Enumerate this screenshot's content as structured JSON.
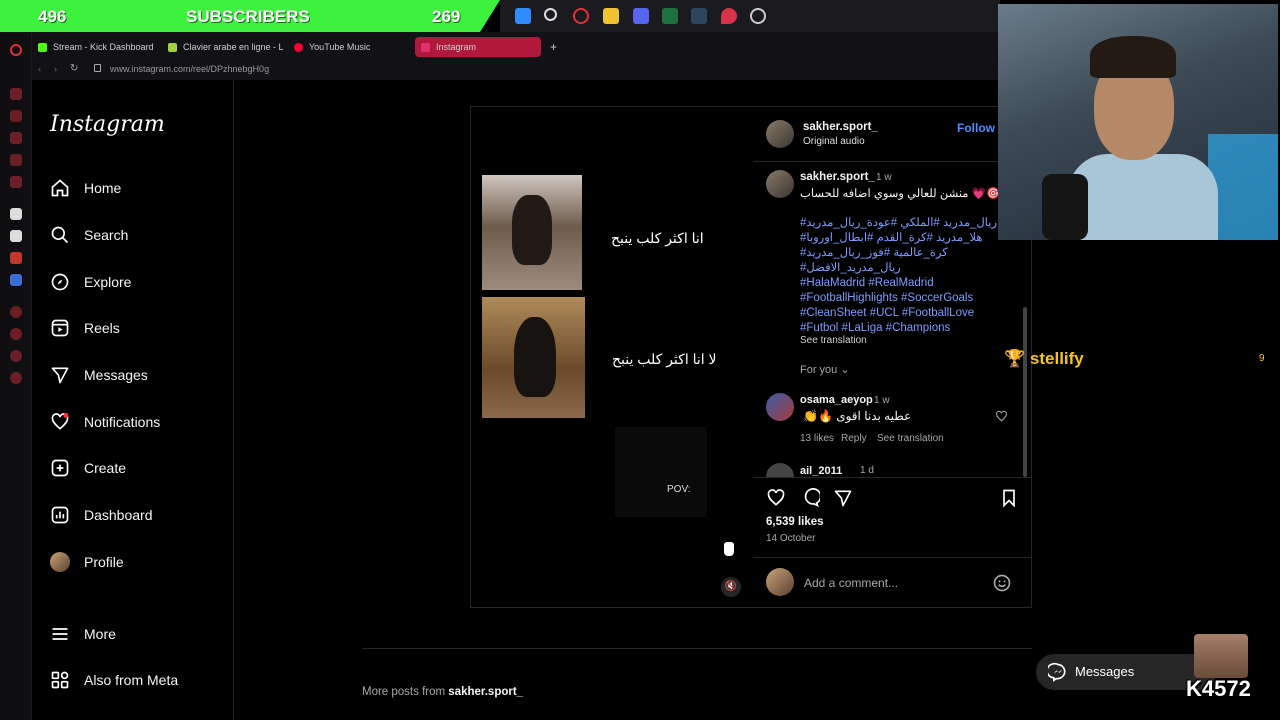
{
  "stream": {
    "subs_left": "496",
    "subs_label": "SUBSCRIBERS",
    "subs_right": "269"
  },
  "browser": {
    "tabs": [
      {
        "label": "Stream - Kick Dashboard",
        "color": "#53fc18"
      },
      {
        "label": "Clavier arabe en ligne - L",
        "color": "#a3d13b"
      },
      {
        "label": "YouTube Music",
        "color": "#ff0033"
      },
      {
        "label": "Instagram",
        "color": "#e1306c"
      }
    ],
    "new_tab": "+",
    "url": "www.instagram.com/reel/DPzhnebgH0g"
  },
  "instagram": {
    "logo": "Instagram",
    "nav": [
      {
        "label": "Home",
        "icon": "home-icon"
      },
      {
        "label": "Search",
        "icon": "search-icon"
      },
      {
        "label": "Explore",
        "icon": "compass-icon"
      },
      {
        "label": "Reels",
        "icon": "reels-icon"
      },
      {
        "label": "Messages",
        "icon": "send-icon"
      },
      {
        "label": "Notifications",
        "icon": "heart-icon"
      },
      {
        "label": "Create",
        "icon": "plus-square-icon"
      },
      {
        "label": "Dashboard",
        "icon": "chart-icon"
      },
      {
        "label": "Profile",
        "icon": "avatar"
      },
      {
        "label": "More",
        "icon": "menu-icon"
      },
      {
        "label": "Also from Meta",
        "icon": "meta-icon"
      }
    ]
  },
  "post": {
    "video": {
      "caption1": "انا اكثر كلب ينبح",
      "caption2": "لا انا اكثر كلب ينبح",
      "pov": "POV:"
    },
    "header": {
      "username": "sakher.sport_",
      "audio": "Original audio",
      "follow": "Follow"
    },
    "caption": {
      "username": "sakher.sport_",
      "time": "1 w",
      "text": "منشن للعالي وسوي اضافه للحساب 💗🎯",
      "hashtags": [
        "#ريال_مدريد #الملكي #عودة_ريال_مدريد",
        "#هلا_مدريد #كرة_القدم #ابطال_اوروبا",
        "#كرة_عالمية #فوز_ريال_مدريد",
        "#ريال_مدريد_الافضل",
        "#HalaMadrid #RealMadrid",
        "#FootballHighlights #SoccerGoals",
        "#CleanSheet #UCL #FootballLove",
        "#Futbol #LaLiga #Champions"
      ],
      "see_translation": "See translation"
    },
    "for_you": "For you",
    "comments": [
      {
        "username": "osama_aeyop",
        "time": "1 w",
        "text": "👏🔥 عطيه بدنا اقوى",
        "likes": "13 likes",
        "reply": "Reply",
        "see_translation": "See translation"
      },
      {
        "username": "ail_2011",
        "time": "1 d"
      }
    ],
    "likes": "6,539 likes",
    "date": "14 October",
    "add_comment_placeholder": "Add a comment...",
    "more_posts_prefix": "More posts from",
    "more_posts_user": "sakher.sport_"
  },
  "overlay": {
    "stellify": "stellify",
    "stellify_count": "9",
    "messages": "Messages",
    "watermark": "K4572"
  }
}
